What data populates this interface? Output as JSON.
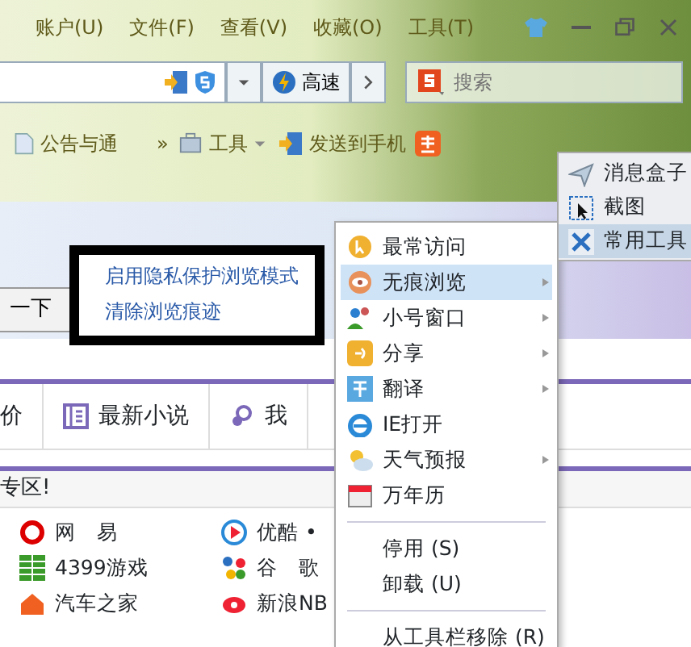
{
  "menu_bar": [
    {
      "label": "账户(U)"
    },
    {
      "label": "文件(F)"
    },
    {
      "label": "查看(V)"
    },
    {
      "label": "收藏(O)"
    },
    {
      "label": "工具(T)"
    }
  ],
  "address_bar": {
    "speed_button": "高速",
    "search_placeholder": "搜索"
  },
  "bookmarks": [
    {
      "label": "公告与通",
      "kind": "link"
    },
    {
      "label": "»",
      "kind": "more"
    },
    {
      "label": "工具",
      "kind": "dropdown"
    },
    {
      "label": "发送到手机",
      "kind": "link"
    }
  ],
  "page": {
    "search_button": "一下",
    "tabs": [
      {
        "label": "价"
      },
      {
        "label": "最新小说"
      },
      {
        "label": "我"
      }
    ],
    "section_title": "专区!",
    "sites": [
      {
        "label": "网　易"
      },
      {
        "label": "优酷 •"
      },
      {
        "label": "4399游戏"
      },
      {
        "label": "谷　歌"
      },
      {
        "label": "汽车之家"
      },
      {
        "label": "新浪NB"
      }
    ]
  },
  "privacy_menu": {
    "items": [
      "启用隐私保护浏览模式",
      "清除浏览痕迹"
    ]
  },
  "tools_menu": {
    "items": [
      {
        "label": "最常访问",
        "kind": "icon",
        "submenu": false,
        "selected": false
      },
      {
        "label": "无痕浏览",
        "kind": "icon",
        "submenu": true,
        "selected": true
      },
      {
        "label": "小号窗口",
        "kind": "icon",
        "submenu": true,
        "selected": false
      },
      {
        "label": "分享",
        "kind": "icon",
        "submenu": true,
        "selected": false
      },
      {
        "label": "翻译",
        "kind": "icon",
        "submenu": true,
        "selected": false
      },
      {
        "label": "IE打开",
        "kind": "icon",
        "submenu": false,
        "selected": false
      },
      {
        "label": "天气预报",
        "kind": "icon",
        "submenu": true,
        "selected": false
      },
      {
        "label": "万年历",
        "kind": "icon",
        "submenu": false,
        "selected": false
      },
      {
        "kind": "separator"
      },
      {
        "label": "停用 (S)",
        "kind": "plain",
        "submenu": false,
        "selected": false
      },
      {
        "label": "卸载 (U)",
        "kind": "plain",
        "submenu": false,
        "selected": false
      },
      {
        "kind": "separator"
      },
      {
        "label": "从工具栏移除 (R)",
        "kind": "plain",
        "submenu": false,
        "selected": false
      }
    ]
  },
  "side_menu": {
    "items": [
      {
        "label": "消息盒子",
        "selected": false
      },
      {
        "label": "截图",
        "selected": false
      },
      {
        "label": "常用工具",
        "selected": true
      }
    ]
  }
}
